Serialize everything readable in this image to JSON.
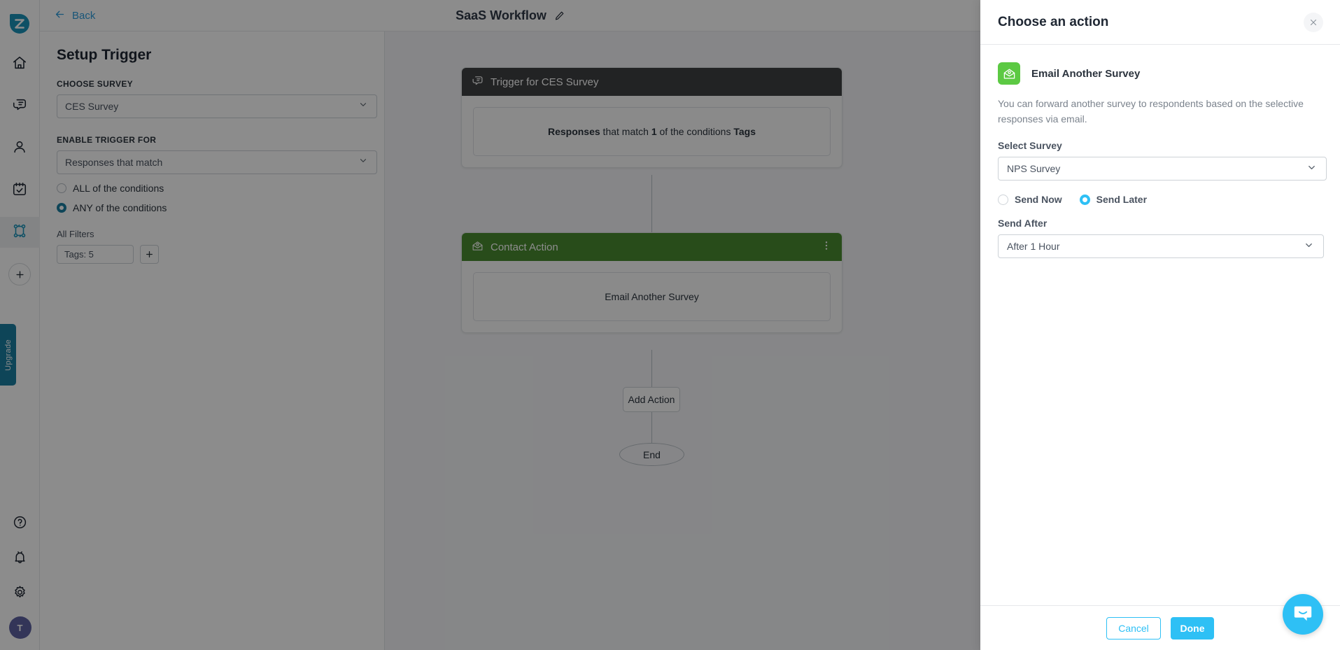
{
  "rail": {
    "logo": "zonka-logo",
    "items": [
      {
        "name": "home",
        "icon": "home-icon",
        "active": false
      },
      {
        "name": "feedback",
        "icon": "chat-icon",
        "active": false
      },
      {
        "name": "contacts",
        "icon": "user-icon",
        "active": false
      },
      {
        "name": "tasks",
        "icon": "calendar-check-icon",
        "active": false
      },
      {
        "name": "workflows",
        "icon": "workflow-icon",
        "active": true
      }
    ],
    "add_label": "+",
    "bottom": [
      {
        "name": "help",
        "icon": "help-circle-icon"
      },
      {
        "name": "notifications",
        "icon": "bell-icon"
      },
      {
        "name": "settings",
        "icon": "gear-icon"
      }
    ],
    "avatar_initial": "T",
    "upgrade_label": "Upgrade"
  },
  "topbar": {
    "back_label": "Back",
    "workflow_title": "SaaS Workflow",
    "edit_icon": "pencil-icon"
  },
  "setup": {
    "title": "Setup Trigger",
    "choose_survey_label": "CHOOSE SURVEY",
    "choose_survey_value": "CES Survey",
    "enable_trigger_label": "ENABLE TRIGGER FOR",
    "enable_trigger_value": "Responses that match",
    "condition_options": [
      {
        "label": "ALL of the conditions",
        "selected": false
      },
      {
        "label": "ANY of the conditions",
        "selected": true
      }
    ],
    "all_filters_label": "All Filters",
    "tag_chip": "Tags: 5",
    "add_filter_label": "+"
  },
  "canvas": {
    "trigger_node": {
      "header": "Trigger for CES Survey",
      "header_icon": "chat-icon",
      "body_parts": [
        "Responses",
        " that match ",
        "1",
        " of the conditions ",
        "Tags"
      ],
      "body_text": "Responses that match 1 of the conditions Tags"
    },
    "action_node": {
      "header": "Contact Action",
      "header_icon": "email-open-icon",
      "menu_icon": "kebab-menu-icon",
      "body_text": "Email Another Survey"
    },
    "add_action_label": "Add Action",
    "end_label": "End"
  },
  "drawer": {
    "title": "Choose an action",
    "close_icon": "close-icon",
    "action_icon": "email-open-icon",
    "action_name": "Email Another Survey",
    "action_description": "You can forward another survey to respondents based on the selective responses via email.",
    "select_survey_label": "Select Survey",
    "select_survey_value": "NPS Survey",
    "send_options": [
      {
        "label": "Send Now",
        "selected": false
      },
      {
        "label": "Send Later",
        "selected": true
      }
    ],
    "send_after_label": "Send After",
    "send_after_value": "After 1 Hour",
    "cancel_label": "Cancel",
    "done_label": "Done"
  },
  "chat": {
    "icon": "chat-smile-icon"
  },
  "colors": {
    "brand": "#1b7fa0",
    "accent": "#2ec0f5",
    "trigger_header": "#3f4043",
    "action_header": "#4a8b30",
    "action_icon_bg": "#5cc943",
    "avatar": "#5d62a0"
  }
}
